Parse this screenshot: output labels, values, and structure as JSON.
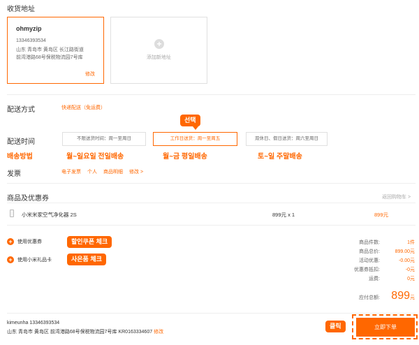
{
  "address": {
    "section_title": "收货地址",
    "name": "ohmyzip",
    "phone": "13346393534",
    "line1": "山东 青岛市 黄岛区 长江路街道",
    "line2": "前湾港路68号保税物流园7号库",
    "edit": "修改",
    "add_new": "添加新地址"
  },
  "shipping": {
    "label": "配送方式",
    "value": "快递配送（免运费）"
  },
  "delivery_time": {
    "label": "配送时间",
    "options": [
      "不限送货时间：周一至周日",
      "工作日送货：周一至周五",
      "双休日、假日送货：周六至周日"
    ],
    "selected_index": 1
  },
  "annotations": {
    "select": "선택",
    "method": "배송방법",
    "opt1": "월~일요일 전일배송",
    "opt2": "월~금 평일배송",
    "opt3": "토~일 주말배송",
    "coupon_check": "할인쿠폰 체크",
    "gift_check": "사은품 체크",
    "click": "클릭"
  },
  "invoice": {
    "label": "发票",
    "items": [
      "电子发票",
      "个人",
      "商品明细",
      "修改 >"
    ]
  },
  "products": {
    "title": "商品及优惠券",
    "back_link": "返回购物车 >",
    "items": [
      {
        "name": "小米米家空气净化器 2S",
        "price_qty": "899元 x 1",
        "total": "899元"
      }
    ]
  },
  "options": {
    "coupon": "使用优惠券",
    "gift_card": "使用小米礼品卡"
  },
  "summary": {
    "rows": [
      {
        "label": "商品件数:",
        "value": "1件"
      },
      {
        "label": "商品总价:",
        "value": "899.00元"
      },
      {
        "label": "活动优惠:",
        "value": "-0.00元"
      },
      {
        "label": "优惠券抵扣:",
        "value": "-0元"
      },
      {
        "label": "运费:",
        "value": "0元"
      }
    ],
    "total_label": "应付总额:",
    "total_value": "899",
    "total_unit": "元"
  },
  "footer": {
    "name_phone": "kimeunha 13346393534",
    "address": "山东 青岛市 黄岛区 前湾港路68号保税物流园7号库 KR0163334607",
    "edit": "修改",
    "submit": "立即下单"
  }
}
